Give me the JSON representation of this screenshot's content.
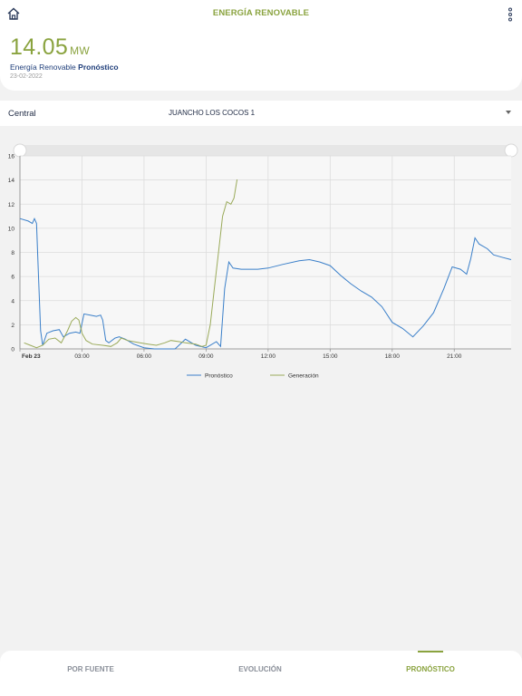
{
  "header": {
    "title": "ENERGÍA RENOVABLE",
    "value": "14.05",
    "unit": "MW",
    "subtitle_prefix": "Energía Renovable",
    "subtitle_strong": "Pronóstico",
    "date": "23-02-2022"
  },
  "selector": {
    "label": "Central",
    "value": "JUANCHO LOS COCOS 1"
  },
  "colors": {
    "accent": "#8aa33f",
    "forecast": "#3a7fc9",
    "generation": "#9aaa5a"
  },
  "icons": [
    "home-icon",
    "more-vertical-icon",
    "chevron-down-icon"
  ],
  "chart_data": {
    "type": "line",
    "x_unit": "hours",
    "xlim": [
      0,
      23.75
    ],
    "ylim": [
      0,
      16
    ],
    "yticks": [
      0,
      2,
      4,
      6,
      8,
      10,
      12,
      14,
      16
    ],
    "xticks": [
      {
        "x": 0,
        "label": "Feb 23",
        "bold": true
      },
      {
        "x": 3,
        "label": "03:00"
      },
      {
        "x": 6,
        "label": "06:00"
      },
      {
        "x": 9,
        "label": "09:00"
      },
      {
        "x": 12,
        "label": "12:00"
      },
      {
        "x": 15,
        "label": "15:00"
      },
      {
        "x": 18,
        "label": "18:00"
      },
      {
        "x": 21,
        "label": "21:00"
      }
    ],
    "grid": true,
    "legend_position": "bottom",
    "series": [
      {
        "name": "Pronóstico",
        "color": "#3a7fc9",
        "points": [
          [
            0,
            10.8
          ],
          [
            0.4,
            10.6
          ],
          [
            0.6,
            10.4
          ],
          [
            0.7,
            10.8
          ],
          [
            0.8,
            10.4
          ],
          [
            0.9,
            6
          ],
          [
            1.0,
            1.5
          ],
          [
            1.1,
            0.3
          ],
          [
            1.3,
            1.3
          ],
          [
            1.6,
            1.5
          ],
          [
            1.9,
            1.6
          ],
          [
            2.1,
            1.0
          ],
          [
            2.4,
            1.3
          ],
          [
            2.7,
            1.4
          ],
          [
            2.9,
            1.3
          ],
          [
            3.1,
            2.9
          ],
          [
            3.4,
            2.8
          ],
          [
            3.7,
            2.7
          ],
          [
            3.9,
            2.8
          ],
          [
            4.0,
            2.4
          ],
          [
            4.15,
            0.7
          ],
          [
            4.3,
            0.5
          ],
          [
            4.6,
            0.9
          ],
          [
            4.8,
            1.0
          ],
          [
            5.1,
            0.8
          ],
          [
            5.5,
            0.4
          ],
          [
            6.0,
            0.1
          ],
          [
            6.5,
            0
          ],
          [
            7.5,
            0
          ],
          [
            8.0,
            0.8
          ],
          [
            8.5,
            0.3
          ],
          [
            9.0,
            0.1
          ],
          [
            9.5,
            0.6
          ],
          [
            9.7,
            0.2
          ],
          [
            9.9,
            5.0
          ],
          [
            10.1,
            7.2
          ],
          [
            10.3,
            6.7
          ],
          [
            10.7,
            6.6
          ],
          [
            11.5,
            6.6
          ],
          [
            12,
            6.7
          ],
          [
            12.7,
            7.0
          ],
          [
            13.5,
            7.3
          ],
          [
            14.0,
            7.4
          ],
          [
            14.5,
            7.2
          ],
          [
            15.0,
            6.9
          ],
          [
            15.5,
            6.1
          ],
          [
            16.0,
            5.4
          ],
          [
            16.5,
            4.8
          ],
          [
            17.0,
            4.3
          ],
          [
            17.5,
            3.5
          ],
          [
            18.0,
            2.2
          ],
          [
            18.5,
            1.7
          ],
          [
            19.0,
            1.0
          ],
          [
            19.5,
            1.9
          ],
          [
            20.0,
            3.0
          ],
          [
            20.5,
            5.0
          ],
          [
            20.9,
            6.8
          ],
          [
            21.3,
            6.6
          ],
          [
            21.6,
            6.2
          ],
          [
            21.8,
            7.5
          ],
          [
            22.0,
            9.2
          ],
          [
            22.2,
            8.7
          ],
          [
            22.6,
            8.3
          ],
          [
            22.9,
            7.8
          ],
          [
            23.3,
            7.6
          ],
          [
            23.75,
            7.4
          ]
        ]
      },
      {
        "name": "Generación",
        "color": "#9aaa5a",
        "points": [
          [
            0.2,
            0.5
          ],
          [
            0.5,
            0.3
          ],
          [
            0.8,
            0.1
          ],
          [
            1.1,
            0.3
          ],
          [
            1.4,
            0.8
          ],
          [
            1.7,
            0.9
          ],
          [
            2.0,
            0.5
          ],
          [
            2.3,
            1.5
          ],
          [
            2.5,
            2.3
          ],
          [
            2.7,
            2.6
          ],
          [
            2.85,
            2.4
          ],
          [
            3.0,
            1.3
          ],
          [
            3.2,
            0.7
          ],
          [
            3.5,
            0.4
          ],
          [
            4.0,
            0.3
          ],
          [
            4.4,
            0.2
          ],
          [
            4.7,
            0.5
          ],
          [
            4.9,
            0.9
          ],
          [
            5.2,
            0.7
          ],
          [
            5.5,
            0.6
          ],
          [
            5.8,
            0.5
          ],
          [
            6.2,
            0.4
          ],
          [
            6.6,
            0.3
          ],
          [
            7.0,
            0.5
          ],
          [
            7.3,
            0.7
          ],
          [
            7.7,
            0.6
          ],
          [
            8.0,
            0.5
          ],
          [
            8.5,
            0.4
          ],
          [
            8.8,
            0.2
          ],
          [
            9.0,
            0.3
          ],
          [
            9.2,
            2.0
          ],
          [
            9.4,
            5.0
          ],
          [
            9.6,
            8.0
          ],
          [
            9.8,
            11.0
          ],
          [
            10.0,
            12.2
          ],
          [
            10.2,
            12.0
          ],
          [
            10.35,
            12.5
          ],
          [
            10.5,
            14.05
          ]
        ]
      }
    ]
  },
  "nav": {
    "tabs": [
      {
        "label": "POR FUENTE",
        "active": false
      },
      {
        "label": "EVOLUCIÓN",
        "active": false
      },
      {
        "label": "PRONÓSTICO",
        "active": true
      }
    ]
  }
}
